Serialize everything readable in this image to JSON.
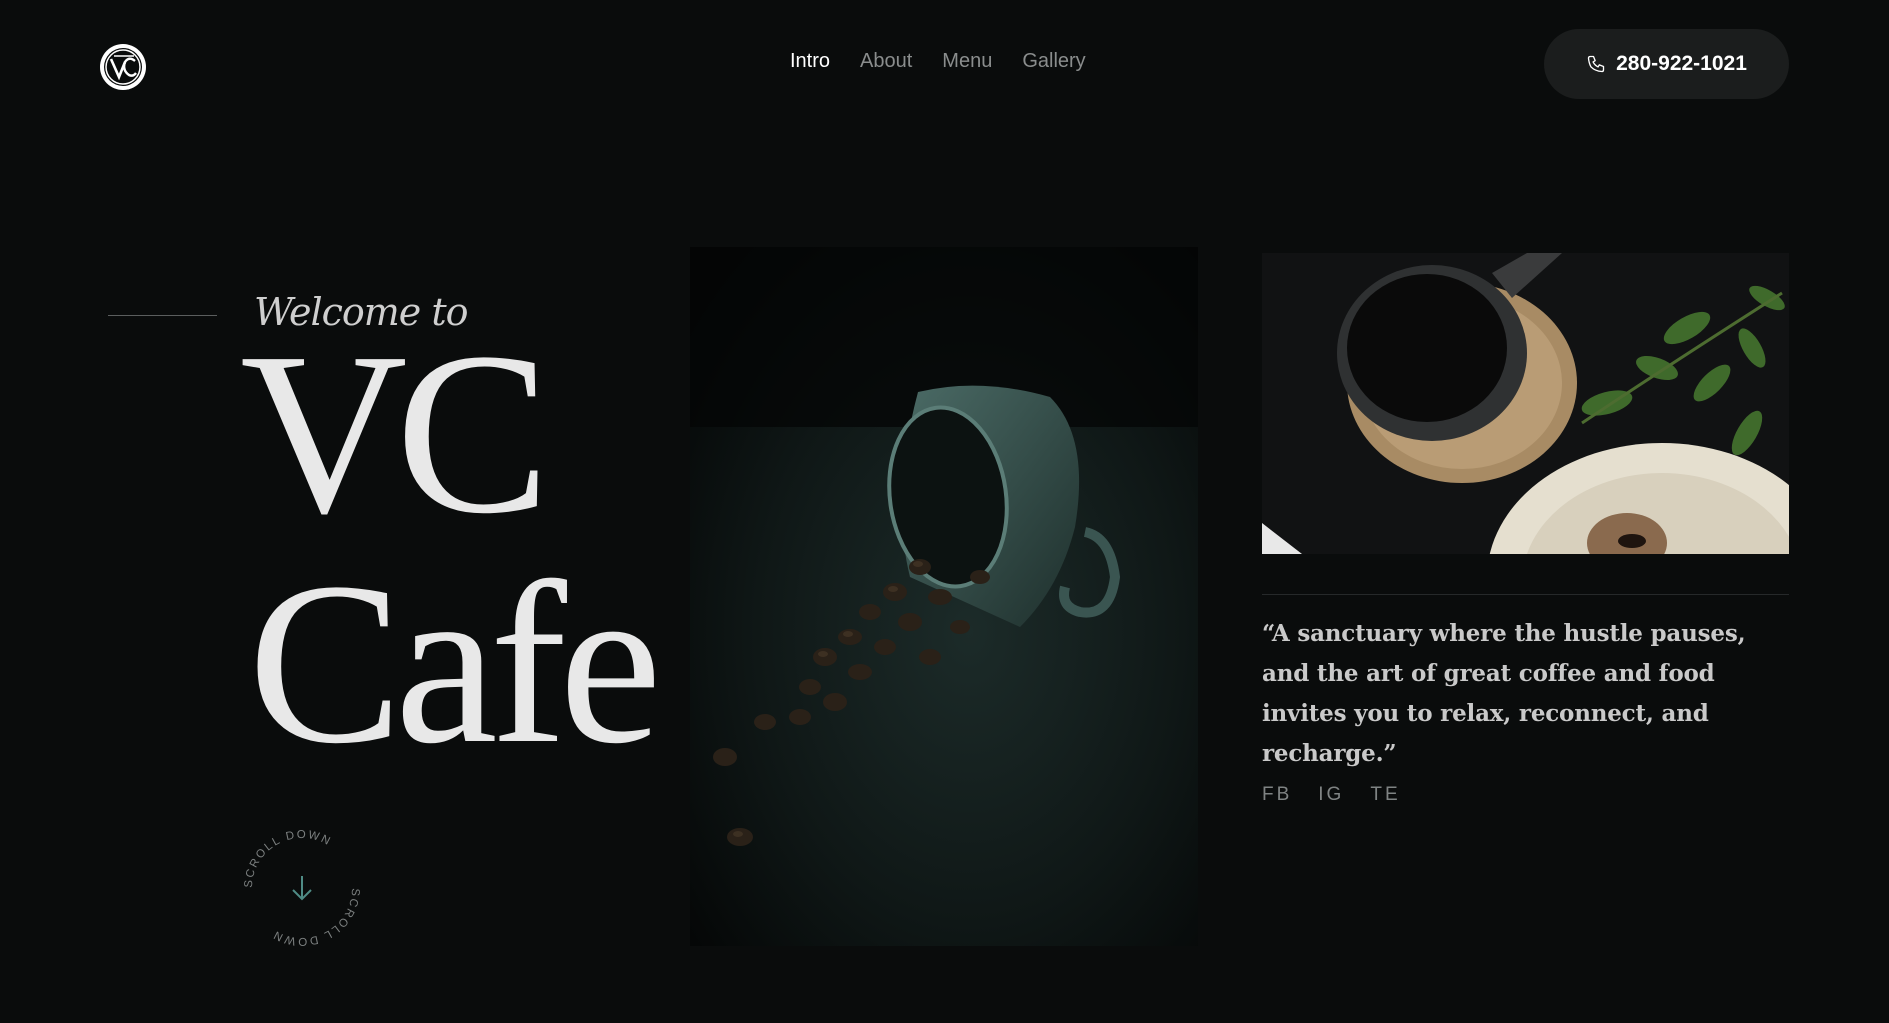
{
  "brand": {
    "logo_icon": "vc-monogram-logo-icon"
  },
  "nav": {
    "items": [
      {
        "label": "Intro",
        "active": true
      },
      {
        "label": "About",
        "active": false
      },
      {
        "label": "Menu",
        "active": false
      },
      {
        "label": "Gallery",
        "active": false
      }
    ]
  },
  "contact": {
    "phone": "280-922-1021",
    "icon": "phone-icon"
  },
  "hero": {
    "welcome": "Welcome to",
    "title_line1": "VC",
    "title_line2": "Cafe",
    "scroll_label": "SCROLL DOWN",
    "scroll_icon": "arrow-down-icon"
  },
  "quote": "“A sanctuary where the hustle pauses, and the art of great coffee and food invites you to relax, reconnect, and recharge.”",
  "socials": [
    {
      "label": "FB"
    },
    {
      "label": "IG"
    },
    {
      "label": "TE"
    }
  ],
  "colors": {
    "background": "#0a0c0c",
    "accent_teal": "#4f8c86",
    "button_bg": "#1b1d1d"
  }
}
